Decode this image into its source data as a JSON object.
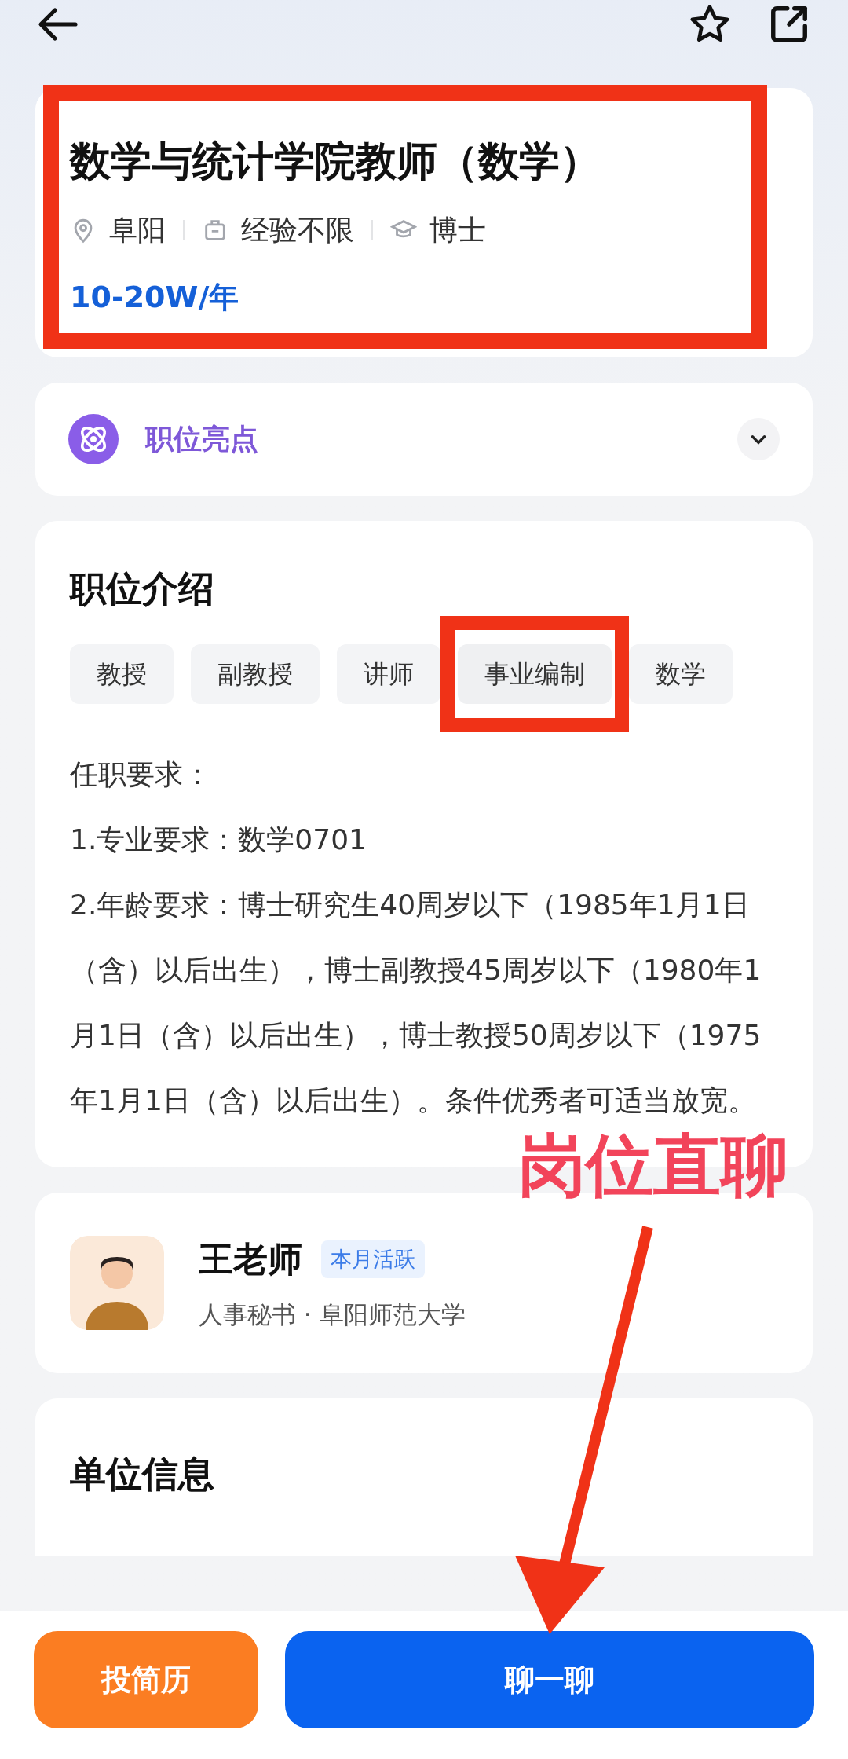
{
  "job": {
    "title": "数学与统计学院教师（数学）",
    "annotated": true,
    "meta": [
      {
        "kind": "location",
        "text": "阜阳"
      },
      {
        "kind": "experience",
        "text": "经验不限"
      },
      {
        "kind": "education",
        "text": "博士"
      }
    ],
    "salary": "10-20W/年"
  },
  "highlights": {
    "label": "职位亮点",
    "expanded": false
  },
  "intro": {
    "heading": "职位介绍",
    "tags": [
      {
        "text": "教授",
        "annotated": false
      },
      {
        "text": "副教授",
        "annotated": false
      },
      {
        "text": "讲师",
        "annotated": false
      },
      {
        "text": "事业编制",
        "annotated": true
      },
      {
        "text": "数学",
        "annotated": false
      }
    ],
    "paragraphs": [
      "任职要求：",
      "1.专业要求：数学0701",
      "2.年龄要求：博士研究生40周岁以下（1985年1月1日（含）以后出生），博士副教授45周岁以下（1980年1月1日（含）以后出生），博士教授50周岁以下（1975年1月1日（含）以后出生）。条件优秀者可适当放宽。"
    ]
  },
  "recruiter": {
    "name": "王老师",
    "badge": "本月活跃",
    "subtitle": "人事秘书 · 阜阳师范大学"
  },
  "employer": {
    "heading": "单位信息"
  },
  "actions": [
    {
      "kind": "secondary",
      "label": "投简历"
    },
    {
      "kind": "primary",
      "label": "聊一聊"
    }
  ],
  "annotation": {
    "callout": "岗位直聊"
  }
}
